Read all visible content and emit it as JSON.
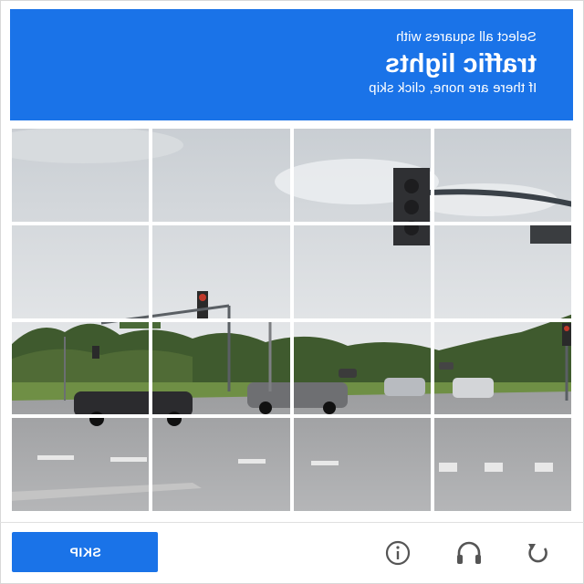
{
  "header": {
    "instruction": "Select all squares with",
    "target": "traffic lights",
    "hint": "If there are none, click skip"
  },
  "grid": {
    "rows": 4,
    "cols": 4
  },
  "footer": {
    "skip_label": "SKIP",
    "icons": [
      "info-icon",
      "headphones-icon",
      "reload-icon"
    ]
  },
  "colors": {
    "accent": "#1a73e8"
  }
}
